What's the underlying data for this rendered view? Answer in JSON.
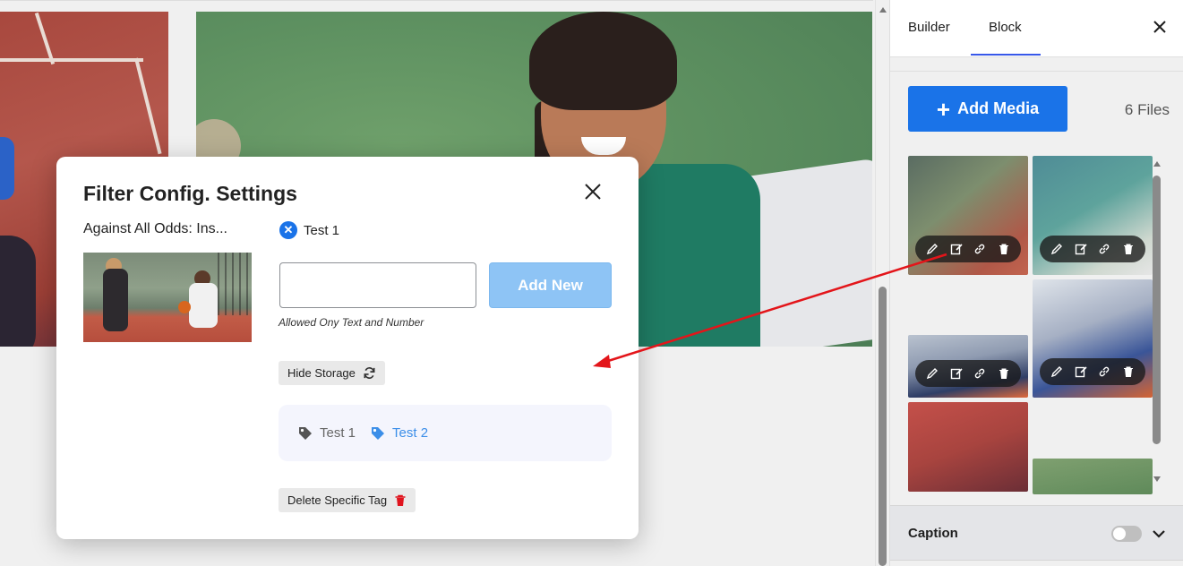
{
  "sidebar": {
    "tabs": [
      {
        "label": "Builder"
      },
      {
        "label": "Block"
      }
    ],
    "close_icon": "close-icon",
    "add_media_label": "Add Media",
    "files_count": "6 Files",
    "thumbnail_tools": [
      "pencil-icon",
      "edit-note-icon",
      "link-icon",
      "trash-icon"
    ],
    "caption_label": "Caption",
    "caption_enabled": false
  },
  "modal": {
    "title": "Filter Config. Settings",
    "media_title": "Against All Odds: Ins...",
    "applied_tags": [
      {
        "label": "Test 1"
      }
    ],
    "input_value": "",
    "input_placeholder": "",
    "add_new_label": "Add New",
    "hint": "Allowed Ony Text and Number",
    "hide_storage_label": "Hide Storage",
    "stored_tags": [
      {
        "label": "Test 1",
        "color": "#666666"
      },
      {
        "label": "Test 2",
        "color": "#3b8ee8"
      }
    ],
    "delete_tag_label": "Delete Specific Tag"
  },
  "colors": {
    "primary": "#1a73e8",
    "add_new_disabled": "#8ec4f5",
    "delete_icon": "#e0141e",
    "annotation_arrow": "#e3151a"
  }
}
